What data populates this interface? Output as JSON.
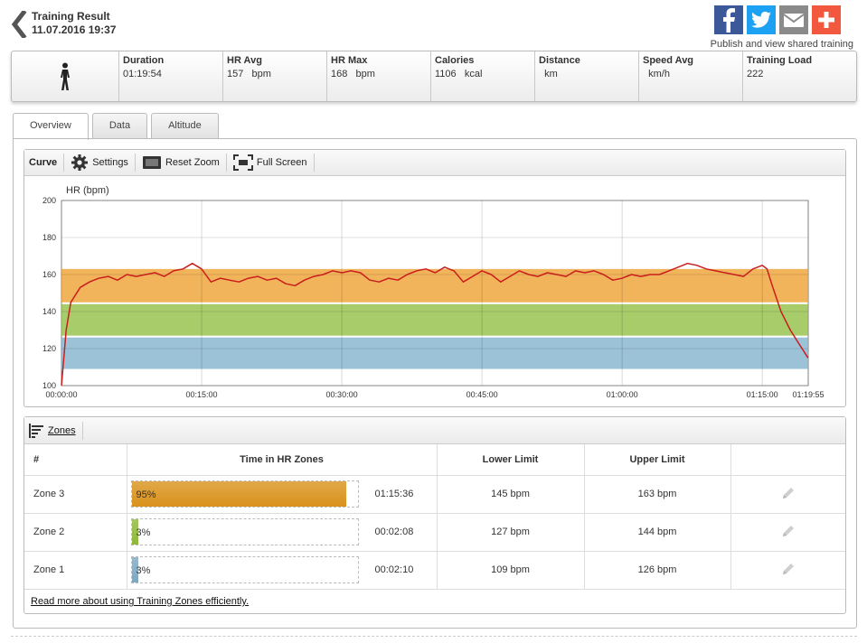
{
  "header": {
    "title": "Training Result",
    "datetime": "11.07.2016 19:37",
    "share_text": "Publish and view shared training"
  },
  "share_buttons": [
    {
      "name": "facebook",
      "color": "#3b5998"
    },
    {
      "name": "twitter",
      "color": "#1da1f2"
    },
    {
      "name": "email",
      "color": "#8a8a8a"
    },
    {
      "name": "plus",
      "color": "#f2583e"
    }
  ],
  "stats": [
    {
      "label": "Duration",
      "value": "01:19:54"
    },
    {
      "label": "HR Avg",
      "value": "157   bpm"
    },
    {
      "label": "HR Max",
      "value": "168   bpm"
    },
    {
      "label": "Calories",
      "value": "1106   kcal"
    },
    {
      "label": "Distance",
      "value": "  km"
    },
    {
      "label": "Speed Avg",
      "value": "  km/h"
    },
    {
      "label": "Training Load",
      "value": "222"
    }
  ],
  "tabs": [
    "Overview",
    "Data",
    "Altitude"
  ],
  "toolbar": {
    "curve": "Curve",
    "settings": "Settings",
    "reset_zoom": "Reset Zoom",
    "full_screen": "Full Screen"
  },
  "chart_data": {
    "type": "line",
    "ylabel": "HR (bpm)",
    "ylim": [
      100,
      200
    ],
    "yticks": [
      100,
      120,
      140,
      160,
      180,
      200
    ],
    "xlim_seconds": [
      0,
      4795
    ],
    "xticks": [
      "00:00:00",
      "00:15:00",
      "00:30:00",
      "00:45:00",
      "01:00:00",
      "01:15:00",
      "01:19:55"
    ],
    "zone_bands": [
      {
        "name": "Zone 3",
        "lower": 145,
        "upper": 163,
        "color": "#f2b45a"
      },
      {
        "name": "Zone 2",
        "lower": 127,
        "upper": 144,
        "color": "#a9cc6a"
      },
      {
        "name": "Zone 1",
        "lower": 109,
        "upper": 126,
        "color": "#9cc2d8"
      }
    ],
    "series": [
      {
        "color": "#c81e1e",
        "x_minutes": [
          0,
          0.5,
          1,
          2,
          3,
          4,
          5,
          6,
          7,
          8,
          9,
          10,
          11,
          12,
          13,
          14,
          15,
          16,
          17,
          18,
          19,
          20,
          21,
          22,
          23,
          24,
          25,
          26,
          27,
          28,
          29,
          30,
          31,
          32,
          33,
          34,
          35,
          36,
          37,
          38,
          39,
          40,
          41,
          42,
          43,
          44,
          45,
          46,
          47,
          48,
          49,
          50,
          51,
          52,
          53,
          54,
          55,
          56,
          57,
          58,
          59,
          60,
          61,
          62,
          63,
          64,
          65,
          66,
          67,
          68,
          69,
          70,
          71,
          72,
          73,
          74,
          75,
          75.5,
          76,
          77,
          78,
          79,
          79.9
        ],
        "y": [
          100,
          130,
          145,
          153,
          156,
          158,
          159,
          157,
          160,
          159,
          160,
          161,
          159,
          162,
          163,
          166,
          163,
          156,
          158,
          157,
          156,
          158,
          159,
          157,
          158,
          155,
          154,
          157,
          159,
          160,
          162,
          161,
          162,
          161,
          157,
          156,
          158,
          157,
          160,
          162,
          163,
          161,
          164,
          162,
          156,
          159,
          162,
          160,
          156,
          159,
          162,
          160,
          159,
          161,
          160,
          159,
          162,
          161,
          162,
          160,
          157,
          158,
          160,
          159,
          160,
          160,
          162,
          164,
          166,
          165,
          163,
          162,
          161,
          160,
          159,
          163,
          165,
          163,
          155,
          140,
          130,
          122,
          115
        ]
      }
    ]
  },
  "zones": {
    "section_label": "Zones",
    "columns": [
      "#",
      "Time in HR Zones",
      "Lower Limit",
      "Upper Limit",
      ""
    ],
    "rows": [
      {
        "name": "Zone 3",
        "percent": 95,
        "percent_label": "95%",
        "time": "01:15:36",
        "lower": "145 bpm",
        "upper": "163 bpm",
        "color": "#d9921c"
      },
      {
        "name": "Zone 2",
        "percent": 3,
        "percent_label": "3%",
        "time": "00:02:08",
        "lower": "127 bpm",
        "upper": "144 bpm",
        "color": "#8fb83a"
      },
      {
        "name": "Zone 1",
        "percent": 3,
        "percent_label": "3%",
        "time": "00:02:10",
        "lower": "109 bpm",
        "upper": "126 bpm",
        "color": "#7fa7c0"
      }
    ],
    "read_more": "Read more about using Training Zones efficiently."
  }
}
